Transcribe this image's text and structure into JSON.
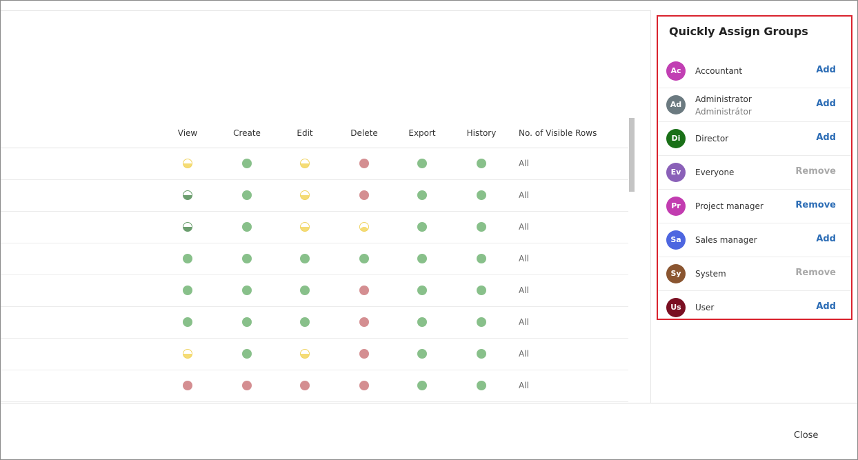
{
  "table": {
    "columns": [
      {
        "key": "view",
        "label": "View"
      },
      {
        "key": "create",
        "label": "Create"
      },
      {
        "key": "edit",
        "label": "Edit"
      },
      {
        "key": "delete",
        "label": "Delete"
      },
      {
        "key": "export",
        "label": "Export"
      },
      {
        "key": "history",
        "label": "History"
      }
    ],
    "rows_label": "No. of Visible Rows",
    "rows": [
      {
        "view": "half-yellow",
        "create": "full-green",
        "edit": "half-yellow",
        "delete": "full-red",
        "export": "full-green",
        "history": "full-green",
        "visible_rows": "All"
      },
      {
        "view": "half-green",
        "create": "full-green",
        "edit": "half-yellow",
        "delete": "full-red",
        "export": "full-green",
        "history": "full-green",
        "visible_rows": "All"
      },
      {
        "view": "half-green",
        "create": "full-green",
        "edit": "half-yellow",
        "delete": "quarter-yellow",
        "export": "full-green",
        "history": "full-green",
        "visible_rows": "All"
      },
      {
        "view": "full-green",
        "create": "full-green",
        "edit": "full-green",
        "delete": "full-green",
        "export": "full-green",
        "history": "full-green",
        "visible_rows": "All"
      },
      {
        "view": "full-green",
        "create": "full-green",
        "edit": "full-green",
        "delete": "full-red",
        "export": "full-green",
        "history": "full-green",
        "visible_rows": "All"
      },
      {
        "view": "full-green",
        "create": "full-green",
        "edit": "full-green",
        "delete": "full-red",
        "export": "full-green",
        "history": "full-green",
        "visible_rows": "All"
      },
      {
        "view": "half-yellow",
        "create": "full-green",
        "edit": "half-yellow",
        "delete": "full-red",
        "export": "full-green",
        "history": "full-green",
        "visible_rows": "All"
      },
      {
        "view": "full-red",
        "create": "full-red",
        "edit": "full-red",
        "delete": "full-red",
        "export": "full-green",
        "history": "full-green",
        "visible_rows": "All"
      }
    ]
  },
  "panel": {
    "title": "Quickly Assign Groups",
    "groups": [
      {
        "initials": "Ac",
        "name": "Accountant",
        "subtitle": "",
        "color": "#c13fb3",
        "action": "Add",
        "action_state": "active"
      },
      {
        "initials": "Ad",
        "name": "Administrator",
        "subtitle": "Administrátor",
        "color": "#6b7a80",
        "action": "Add",
        "action_state": "active"
      },
      {
        "initials": "Di",
        "name": "Director",
        "subtitle": "",
        "color": "#1a7018",
        "action": "Add",
        "action_state": "active"
      },
      {
        "initials": "Ev",
        "name": "Everyone",
        "subtitle": "",
        "color": "#8a60b8",
        "action": "Remove",
        "action_state": "disabled"
      },
      {
        "initials": "Pr",
        "name": "Project manager",
        "subtitle": "",
        "color": "#c23cb0",
        "action": "Remove",
        "action_state": "active"
      },
      {
        "initials": "Sa",
        "name": "Sales manager",
        "subtitle": "",
        "color": "#4d66e0",
        "action": "Add",
        "action_state": "active"
      },
      {
        "initials": "Sy",
        "name": "System",
        "subtitle": "",
        "color": "#8a5530",
        "action": "Remove",
        "action_state": "disabled"
      },
      {
        "initials": "Us",
        "name": "User",
        "subtitle": "",
        "color": "#7a0f22",
        "action": "Add",
        "action_state": "active"
      }
    ]
  },
  "footer": {
    "close_label": "Close"
  }
}
